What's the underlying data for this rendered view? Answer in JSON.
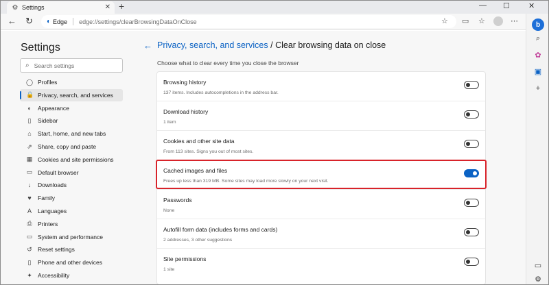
{
  "browser": {
    "tab_title": "Settings",
    "tab_close": "✕",
    "new_tab": "+",
    "window_controls": {
      "minimize": "—",
      "maximize": "☐",
      "close": "✕"
    },
    "nav": {
      "back": "←",
      "refresh": "↻"
    },
    "address": {
      "badge": "Edge",
      "url": "edge://settings/clearBrowsingDataOnClose"
    }
  },
  "settings_nav": {
    "title": "Settings",
    "search_placeholder": "Search settings",
    "items": [
      {
        "label": "Profiles",
        "icon": "profile-icon",
        "glyph": "◯"
      },
      {
        "label": "Privacy, search, and services",
        "icon": "lock-icon",
        "glyph": "🔒",
        "active": true
      },
      {
        "label": "Appearance",
        "icon": "appearance-icon",
        "glyph": "◐"
      },
      {
        "label": "Sidebar",
        "icon": "sidebar-icon",
        "glyph": "▯"
      },
      {
        "label": "Start, home, and new tabs",
        "icon": "home-icon",
        "glyph": "⌂"
      },
      {
        "label": "Share, copy and paste",
        "icon": "share-icon",
        "glyph": "⇗"
      },
      {
        "label": "Cookies and site permissions",
        "icon": "cookie-icon",
        "glyph": "▦"
      },
      {
        "label": "Default browser",
        "icon": "browser-icon",
        "glyph": "▭"
      },
      {
        "label": "Downloads",
        "icon": "download-icon",
        "glyph": "↓"
      },
      {
        "label": "Family",
        "icon": "family-icon",
        "glyph": "♥"
      },
      {
        "label": "Languages",
        "icon": "languages-icon",
        "glyph": "A"
      },
      {
        "label": "Printers",
        "icon": "printer-icon",
        "glyph": "⎙"
      },
      {
        "label": "System and performance",
        "icon": "system-icon",
        "glyph": "▭"
      },
      {
        "label": "Reset settings",
        "icon": "reset-icon",
        "glyph": "↺"
      },
      {
        "label": "Phone and other devices",
        "icon": "phone-icon",
        "glyph": "▯"
      },
      {
        "label": "Accessibility",
        "icon": "accessibility-icon",
        "glyph": "✦"
      }
    ]
  },
  "main": {
    "breadcrumb_parent": "Privacy, search, and services",
    "breadcrumb_separator": " / ",
    "page_title": "Clear browsing data on close",
    "intro": "Choose what to clear every time you close the browser",
    "options": [
      {
        "title": "Browsing history",
        "desc": "137 items. Includes autocompletions in the address bar.",
        "enabled": false
      },
      {
        "title": "Download history",
        "desc": "1 item",
        "enabled": false
      },
      {
        "title": "Cookies and other site data",
        "desc": "From 113 sites. Signs you out of most sites.",
        "enabled": false
      },
      {
        "title": "Cached images and files",
        "desc": "Frees up less than 319 MB. Some sites may load more slowly on your next visit.",
        "enabled": true,
        "highlighted": true
      },
      {
        "title": "Passwords",
        "desc": "None",
        "enabled": false
      },
      {
        "title": "Autofill form data (includes forms and cards)",
        "desc": "2 addresses, 3 other suggestions",
        "enabled": false
      },
      {
        "title": "Site permissions",
        "desc": "1 site",
        "enabled": false
      }
    ]
  },
  "colors": {
    "accent": "#0b62c4",
    "highlight": "#d8232a",
    "pane_bg": "#f7f7f7"
  }
}
